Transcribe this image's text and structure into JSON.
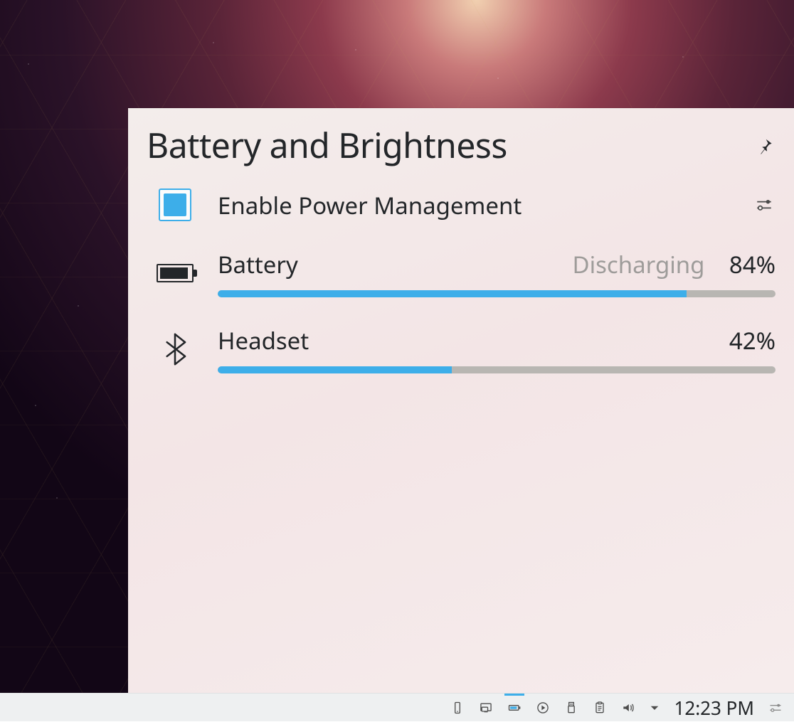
{
  "popup": {
    "title": "Battery and Brightness",
    "power_management": {
      "label": "Enable Power Management",
      "checked": true
    },
    "devices": [
      {
        "name": "Battery",
        "status": "Discharging",
        "percent_label": "84%",
        "percent_value": 84,
        "icon": "battery"
      },
      {
        "name": "Headset",
        "status": "",
        "percent_label": "42%",
        "percent_value": 42,
        "icon": "bluetooth"
      }
    ]
  },
  "taskbar": {
    "time": "12:23 PM",
    "tray": [
      {
        "id": "phone",
        "active": false
      },
      {
        "id": "display",
        "active": false
      },
      {
        "id": "battery",
        "active": true
      },
      {
        "id": "media",
        "active": false
      },
      {
        "id": "usb",
        "active": false
      },
      {
        "id": "clipboard",
        "active": false
      },
      {
        "id": "volume",
        "active": false
      }
    ]
  },
  "colors": {
    "accent": "#3daee9",
    "track": "#b8b6b2",
    "text": "#232629",
    "muted": "#9e9c9a"
  }
}
